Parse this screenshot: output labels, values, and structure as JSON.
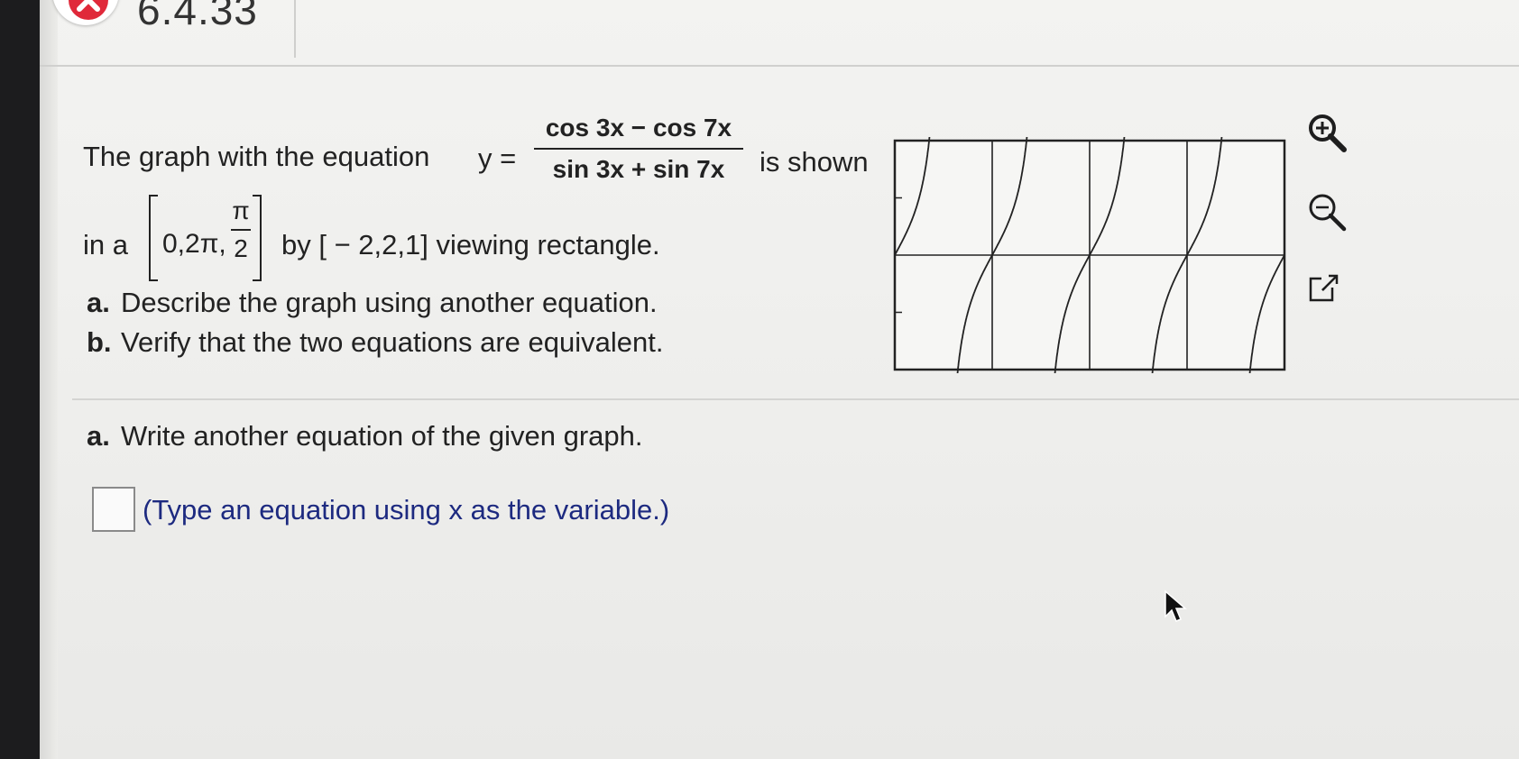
{
  "header": {
    "problem_number": "6.4.33",
    "status": "incorrect"
  },
  "question": {
    "intro_text": "The graph with the equation",
    "y_equals": "y =",
    "numerator": "cos 3x − cos 7x",
    "denominator": "sin 3x + sin 7x",
    "is_shown": "is shown",
    "in_a": "in a",
    "x_range_text": "0,2π,",
    "pi_numerator": "π",
    "pi_denominator": "2",
    "by_text": "by [ − 2,2,1] viewing rectangle.",
    "part_a_label": "a.",
    "part_a_text": "Describe the graph using another equation.",
    "part_b_label": "b.",
    "part_b_text": "Verify that the two equations are equivalent."
  },
  "answer": {
    "prompt_label": "a.",
    "prompt_text": "Write another equation of the given graph.",
    "input_value": "",
    "hint": "(Type an equation using x as the variable.)"
  },
  "toolbar": {
    "icons": [
      "zoom-in-icon",
      "zoom-out-icon",
      "popout-icon"
    ]
  },
  "colors": {
    "incorrect_red": "#e0293a",
    "hint_blue": "#1d2a80"
  },
  "chart_data": {
    "type": "line",
    "title": "",
    "xlabel": "",
    "ylabel": "",
    "equation": "tan 2x",
    "xlim": [
      0,
      6.2832
    ],
    "ylim": [
      -2,
      2
    ],
    "x_scale": 1.5708,
    "y_scale": 1,
    "grid": true,
    "series": [
      {
        "values_from": "y = tan(2x), asymptotes at x = π/4 + kπ/2"
      }
    ]
  }
}
